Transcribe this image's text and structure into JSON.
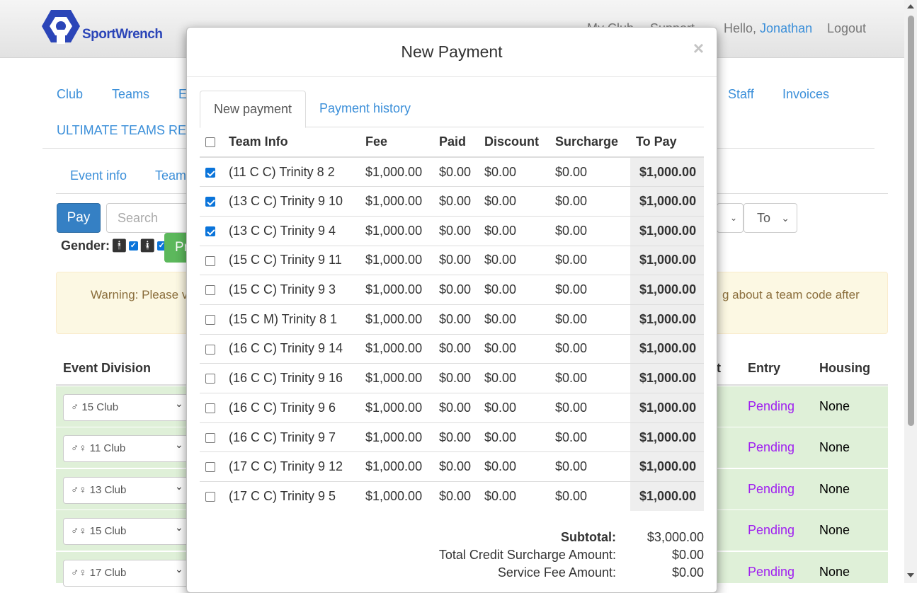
{
  "header": {
    "logo_text": "SportWrench",
    "nav": {
      "my_club": "My Club",
      "support": "Support",
      "hello": "Hello,",
      "user": "Jonathan",
      "logout": "Logout"
    }
  },
  "menu": {
    "club": "Club",
    "teams": "Teams",
    "e_partial": "E",
    "staff": "Staff",
    "invoices": "Invoices",
    "ultimate": "ULTIMATE TEAMS REF"
  },
  "subtabs": {
    "event_info": "Event info",
    "teams": "Teams"
  },
  "toolbar": {
    "pay": "Pay",
    "search_placeholder": "Search",
    "to_select": "To",
    "gender_label": "Gender:",
    "green_btn_partial": "Pr"
  },
  "warning": {
    "left": "Warning: Please v",
    "right": "g about a team code after"
  },
  "bg_table": {
    "headers": {
      "event_division": "Event Division",
      "t_partial": "t",
      "entry": "Entry",
      "housing": "Housing"
    },
    "rows": [
      {
        "division": "♂ 15 Club",
        "entry": "Pending",
        "housing": "None"
      },
      {
        "division": "♂♀ 11 Club",
        "entry": "Pending",
        "housing": "None"
      },
      {
        "division": "♂♀ 13 Club",
        "entry": "Pending",
        "housing": "None"
      },
      {
        "division": "♂♀ 15 Club",
        "entry": "Pending",
        "housing": "None"
      },
      {
        "division": "♂♀ 17 Club",
        "entry": "Pending",
        "housing": "None"
      }
    ]
  },
  "modal": {
    "title": "New Payment",
    "close": "×",
    "tabs": {
      "new_payment": "New payment",
      "history": "Payment history"
    },
    "columns": {
      "team_info": "Team Info",
      "fee": "Fee",
      "paid": "Paid",
      "discount": "Discount",
      "surcharge": "Surcharge",
      "to_pay": "To Pay"
    },
    "rows": [
      {
        "checked": true,
        "team": "(11 C C) Trinity 8 2",
        "fee": "$1,000.00",
        "paid": "$0.00",
        "discount": "$0.00",
        "surcharge": "$0.00",
        "to_pay": "$1,000.00"
      },
      {
        "checked": true,
        "team": "(13 C C) Trinity 9 10",
        "fee": "$1,000.00",
        "paid": "$0.00",
        "discount": "$0.00",
        "surcharge": "$0.00",
        "to_pay": "$1,000.00"
      },
      {
        "checked": true,
        "team": "(13 C C) Trinity 9 4",
        "fee": "$1,000.00",
        "paid": "$0.00",
        "discount": "$0.00",
        "surcharge": "$0.00",
        "to_pay": "$1,000.00"
      },
      {
        "checked": false,
        "team": "(15 C C) Trinity 9 11",
        "fee": "$1,000.00",
        "paid": "$0.00",
        "discount": "$0.00",
        "surcharge": "$0.00",
        "to_pay": "$1,000.00"
      },
      {
        "checked": false,
        "team": "(15 C C) Trinity 9 3",
        "fee": "$1,000.00",
        "paid": "$0.00",
        "discount": "$0.00",
        "surcharge": "$0.00",
        "to_pay": "$1,000.00"
      },
      {
        "checked": false,
        "team": "(15 C M) Trinity 8 1",
        "fee": "$1,000.00",
        "paid": "$0.00",
        "discount": "$0.00",
        "surcharge": "$0.00",
        "to_pay": "$1,000.00"
      },
      {
        "checked": false,
        "team": "(16 C C) Trinity 9 14",
        "fee": "$1,000.00",
        "paid": "$0.00",
        "discount": "$0.00",
        "surcharge": "$0.00",
        "to_pay": "$1,000.00"
      },
      {
        "checked": false,
        "team": "(16 C C) Trinity 9 16",
        "fee": "$1,000.00",
        "paid": "$0.00",
        "discount": "$0.00",
        "surcharge": "$0.00",
        "to_pay": "$1,000.00"
      },
      {
        "checked": false,
        "team": "(16 C C) Trinity 9 6",
        "fee": "$1,000.00",
        "paid": "$0.00",
        "discount": "$0.00",
        "surcharge": "$0.00",
        "to_pay": "$1,000.00"
      },
      {
        "checked": false,
        "team": "(16 C C) Trinity 9 7",
        "fee": "$1,000.00",
        "paid": "$0.00",
        "discount": "$0.00",
        "surcharge": "$0.00",
        "to_pay": "$1,000.00"
      },
      {
        "checked": false,
        "team": "(17 C C) Trinity 9 12",
        "fee": "$1,000.00",
        "paid": "$0.00",
        "discount": "$0.00",
        "surcharge": "$0.00",
        "to_pay": "$1,000.00"
      },
      {
        "checked": false,
        "team": "(17 C C) Trinity 9 5",
        "fee": "$1,000.00",
        "paid": "$0.00",
        "discount": "$0.00",
        "surcharge": "$0.00",
        "to_pay": "$1,000.00"
      }
    ],
    "totals": [
      {
        "label": "Subtotal:",
        "value": "$3,000.00",
        "bold": true
      },
      {
        "label": "Total Credit Surcharge Amount:",
        "value": "$0.00",
        "bold": false
      },
      {
        "label": "Service Fee Amount:",
        "value": "$0.00",
        "bold": false
      }
    ]
  },
  "colors": {
    "accent": "#3b8fd9",
    "primary_button": "#3580c4",
    "success": "#5cb85c",
    "pending": "#a020f0",
    "row_success": "#dff0d8"
  }
}
